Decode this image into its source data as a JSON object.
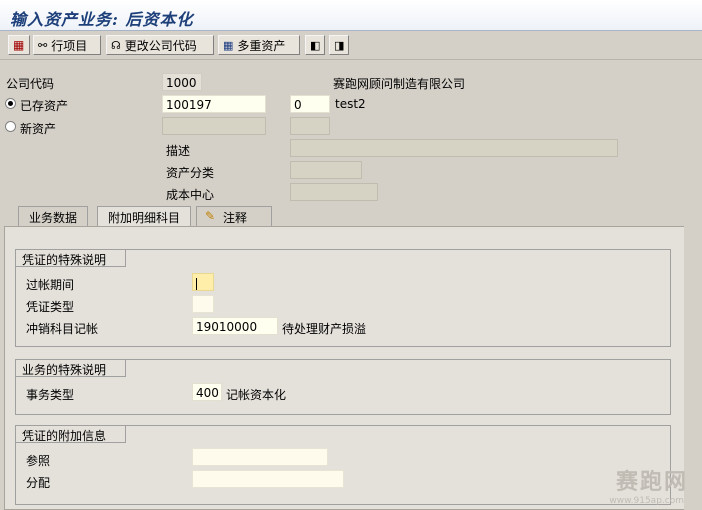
{
  "title": "输入资产业务: 后资本化",
  "toolbar": {
    "line_items": "行项目",
    "change_company": "更改公司代码",
    "multiple_assets": "多重资产"
  },
  "header": {
    "company_code_label": "公司代码",
    "company_code_value": "1000",
    "company_name": "赛跑网顾问制造有限公司",
    "existing_asset_label": "已存资产",
    "existing_asset_value": "100197",
    "sub_number": "0",
    "asset_desc": "test2",
    "new_asset_label": "新资产",
    "description_label": "描述",
    "asset_class_label": "资产分类",
    "cost_center_label": "成本中心"
  },
  "tabs": [
    "业务数据",
    "附加明细科目",
    "注释"
  ],
  "groups": {
    "doc_special": {
      "title": "凭证的特殊说明",
      "posting_period_label": "过帐期间",
      "doc_type_label": "凭证类型",
      "offset_account_label": "冲销科目记帐",
      "offset_account_value": "19010000",
      "offset_account_desc": "待处理财产损溢"
    },
    "trans_special": {
      "title": "业务的特殊说明",
      "trans_type_label": "事务类型",
      "trans_type_value": "400",
      "trans_type_desc": "记帐资本化"
    },
    "doc_extra": {
      "title": "凭证的附加信息",
      "reference_label": "参照",
      "assignment_label": "分配"
    }
  },
  "watermark": {
    "text": "赛跑网",
    "url": "www.915ap.com"
  }
}
